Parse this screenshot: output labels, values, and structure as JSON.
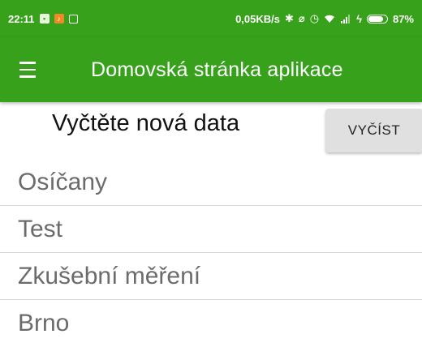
{
  "status_bar": {
    "time": "22:11",
    "network_speed": "0,05KB/s",
    "battery_percent": "87%",
    "battery_level": 0.87,
    "bg_color": "#37a11b",
    "icons": [
      "sim-icon",
      "app-notification-icon",
      "screenshot-icon",
      "bluetooth-icon",
      "vibrate-icon",
      "alarm-icon",
      "wifi-icon",
      "signal-icon",
      "charging-icon",
      "battery-icon"
    ]
  },
  "app_bar": {
    "title": "Domovská stránka aplikace",
    "menu_icon": "hamburger-menu-icon",
    "color": "#37a11b"
  },
  "main": {
    "section_title": "Vyčtěte nová data",
    "read_button_label": "VYČÍST",
    "items": [
      {
        "label": "Osíčany"
      },
      {
        "label": "Test"
      },
      {
        "label": "Zkušební měření"
      },
      {
        "label": "Brno"
      }
    ]
  }
}
